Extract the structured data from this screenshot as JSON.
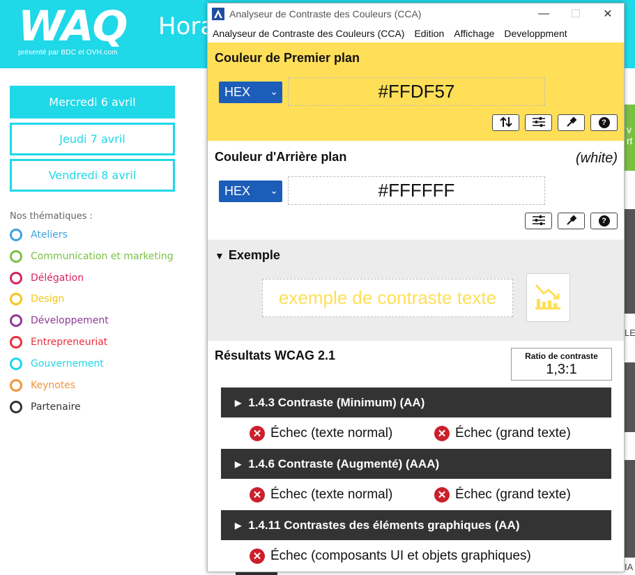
{
  "site": {
    "logo_text": "WAQ",
    "logo_sub": "présenté par  BDC  et  OVH.com",
    "header_title": "Hora",
    "day_tabs": [
      "Mercredi 6 avril",
      "Jeudi 7 avril",
      "Vendredi 8 avril"
    ],
    "themes_title": "Nos thématiques :",
    "themes": [
      {
        "label": "Ateliers",
        "color": "#3ea0db"
      },
      {
        "label": "Communication et marketing",
        "color": "#7bc043"
      },
      {
        "label": "Délégation",
        "color": "#d6245c"
      },
      {
        "label": "Design",
        "color": "#f5c518"
      },
      {
        "label": "Développement",
        "color": "#8e3a96"
      },
      {
        "label": "Entrepreneuriat",
        "color": "#e8303a"
      },
      {
        "label": "Gouvernement",
        "color": "#1fd8e8"
      },
      {
        "label": "Keynotes",
        "color": "#f3933a"
      },
      {
        "label": "Partenaire",
        "color": "#333333"
      }
    ],
    "right_fragments": [
      "v",
      "rt",
      "LE",
      "IA"
    ]
  },
  "window": {
    "title": "Analyseur de Contraste des Couleurs (CCA)",
    "menu": [
      "Analyseur de Contraste des Couleurs (CCA)",
      "Edition",
      "Affichage",
      "Developpment"
    ],
    "foreground": {
      "title": "Couleur de Premier plan",
      "format": "HEX",
      "value": "#FFDF57",
      "color": "#FFDF57"
    },
    "background": {
      "title": "Couleur d'Arrière plan",
      "name": "(white)",
      "format": "HEX",
      "value": "#FFFFFF"
    },
    "example": {
      "title": "Exemple",
      "text": "exemple de contraste texte"
    },
    "results": {
      "title": "Résultats WCAG 2.1",
      "ratio_label": "Ratio de contraste",
      "ratio_value": "1,3:1",
      "criteria": [
        {
          "label": "1.4.3 Contraste (Minimum) (AA)",
          "results": [
            "Échec (texte normal)",
            "Échec (grand texte)"
          ]
        },
        {
          "label": "1.4.6 Contraste (Augmenté) (AAA)",
          "results": [
            "Échec (texte normal)",
            "Échec (grand texte)"
          ]
        },
        {
          "label": "1.4.11 Contrastes des éléments graphiques (AA)",
          "results": [
            "Échec (composants UI et objets graphiques)"
          ]
        }
      ]
    }
  }
}
